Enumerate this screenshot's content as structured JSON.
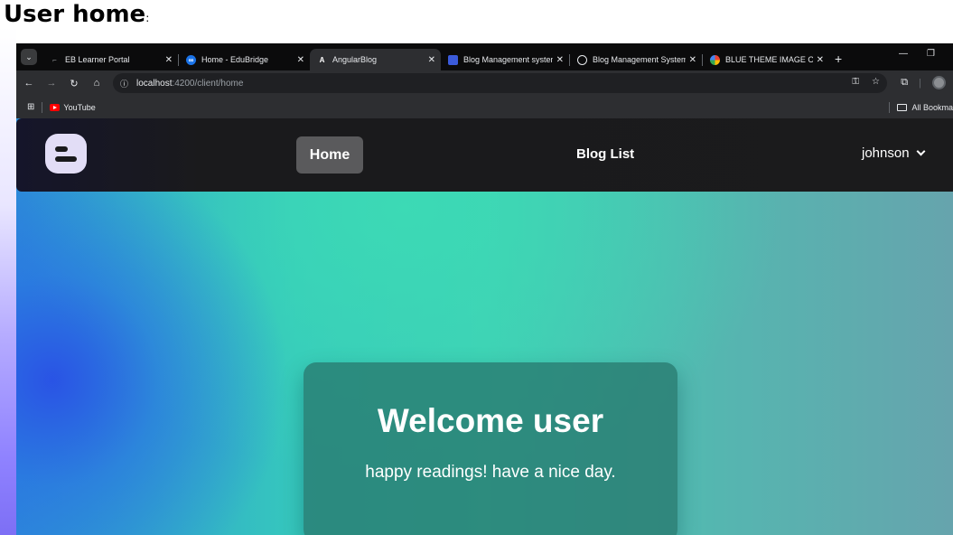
{
  "doc": {
    "heading": "User home",
    "heading_suffix": ":"
  },
  "browser": {
    "tabs": [
      {
        "title": "EB Learner Portal",
        "favicon": "eb-portal-icon",
        "active": false
      },
      {
        "title": "Home - EduBridge",
        "favicon": "edubridge-icon",
        "active": false
      },
      {
        "title": "AngularBlog",
        "favicon": "angular-icon",
        "favicon_text": "A",
        "active": true
      },
      {
        "title": "Blog Management system",
        "favicon": "blog-app-icon",
        "active": false
      },
      {
        "title": "Blog Management System",
        "favicon": "globe-icon",
        "active": false
      },
      {
        "title": "BLUE THEME IMAGE OG H",
        "favicon": "google-icon",
        "active": false
      }
    ],
    "url_host": "localhost",
    "url_path": ":4200/client/home",
    "bookmarks": [
      {
        "label": "YouTube",
        "icon": "youtube-icon"
      }
    ],
    "bookmarks_right": "All Bookma"
  },
  "app": {
    "nav": {
      "home": "Home",
      "blog_list": "Blog List",
      "user": "johnson"
    },
    "welcome": {
      "title": "Welcome user",
      "subtitle": "happy readings! have a nice day."
    }
  },
  "colors": {
    "accent_card": "#2a7a6e",
    "nav_bg": "#1b1b1c",
    "logo": "#e2ddf6"
  }
}
